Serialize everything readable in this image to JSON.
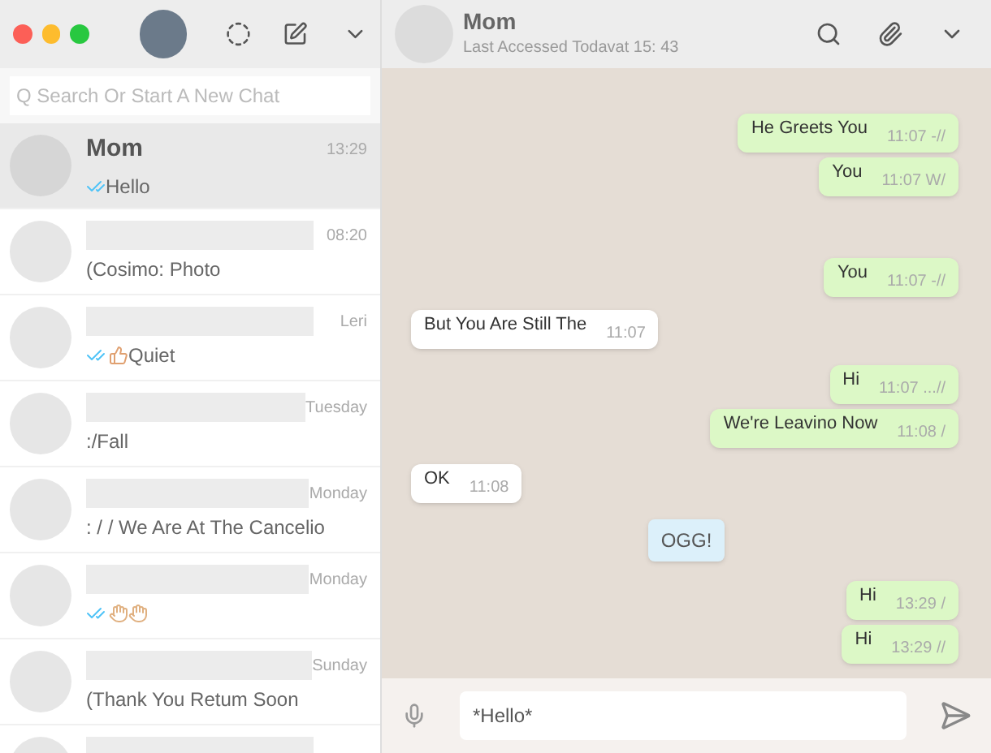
{
  "search": {
    "placeholder": "Q Search Or Start A New Chat"
  },
  "chats": [
    {
      "kind": "text",
      "name": "Mom",
      "time": "13:29",
      "preview": "Hello",
      "ticks": true,
      "selected": true
    },
    {
      "kind": "text",
      "time": "08:20",
      "preview": "(Cosimo: Photo",
      "ticks": false,
      "selected": false
    },
    {
      "kind": "thumbs",
      "time": "Leri",
      "preview": "Quiet",
      "ticks": true,
      "selected": false
    },
    {
      "kind": "text",
      "time": "Tuesday",
      "preview": ":/Fall",
      "ticks": false,
      "selected": false
    },
    {
      "kind": "text",
      "time": "Monday",
      "preview": ": / / We Are At The Cancelio",
      "ticks": false,
      "selected": false
    },
    {
      "kind": "hands",
      "time": "Monday",
      "ticks": true,
      "selected": false
    },
    {
      "kind": "text",
      "time": "Sunday",
      "preview": "(Thank You Retum Soon",
      "ticks": false,
      "selected": false
    },
    {
      "kind": "text",
      "ticks": false,
      "selected": false
    }
  ],
  "conversation": {
    "name": "Mom",
    "status": "Last Accessed Todavat 15: 43"
  },
  "messages": [
    {
      "kind": "out",
      "text": "He Greets You",
      "time": "11:07 -//"
    },
    {
      "kind": "out",
      "text": "You",
      "time": "11:07 W/"
    },
    {
      "kind": "out",
      "text": "You",
      "time": "11:07 -//"
    },
    {
      "kind": "in",
      "text": "But You Are Still The",
      "time": "11:07"
    },
    {
      "kind": "out",
      "text": "Hi",
      "time": "11:07 ...//"
    },
    {
      "kind": "out",
      "text": "We're Leavino Now",
      "time": "11:08 /"
    },
    {
      "kind": "in",
      "text": "OK",
      "time": "11:08"
    },
    {
      "kind": "system",
      "text": "OGG!"
    },
    {
      "kind": "out",
      "text": "Hi",
      "time": "13:29 /"
    },
    {
      "kind": "out",
      "text": "Hi",
      "time": "13:29 //"
    }
  ],
  "composer": {
    "value": "*Hello*"
  }
}
